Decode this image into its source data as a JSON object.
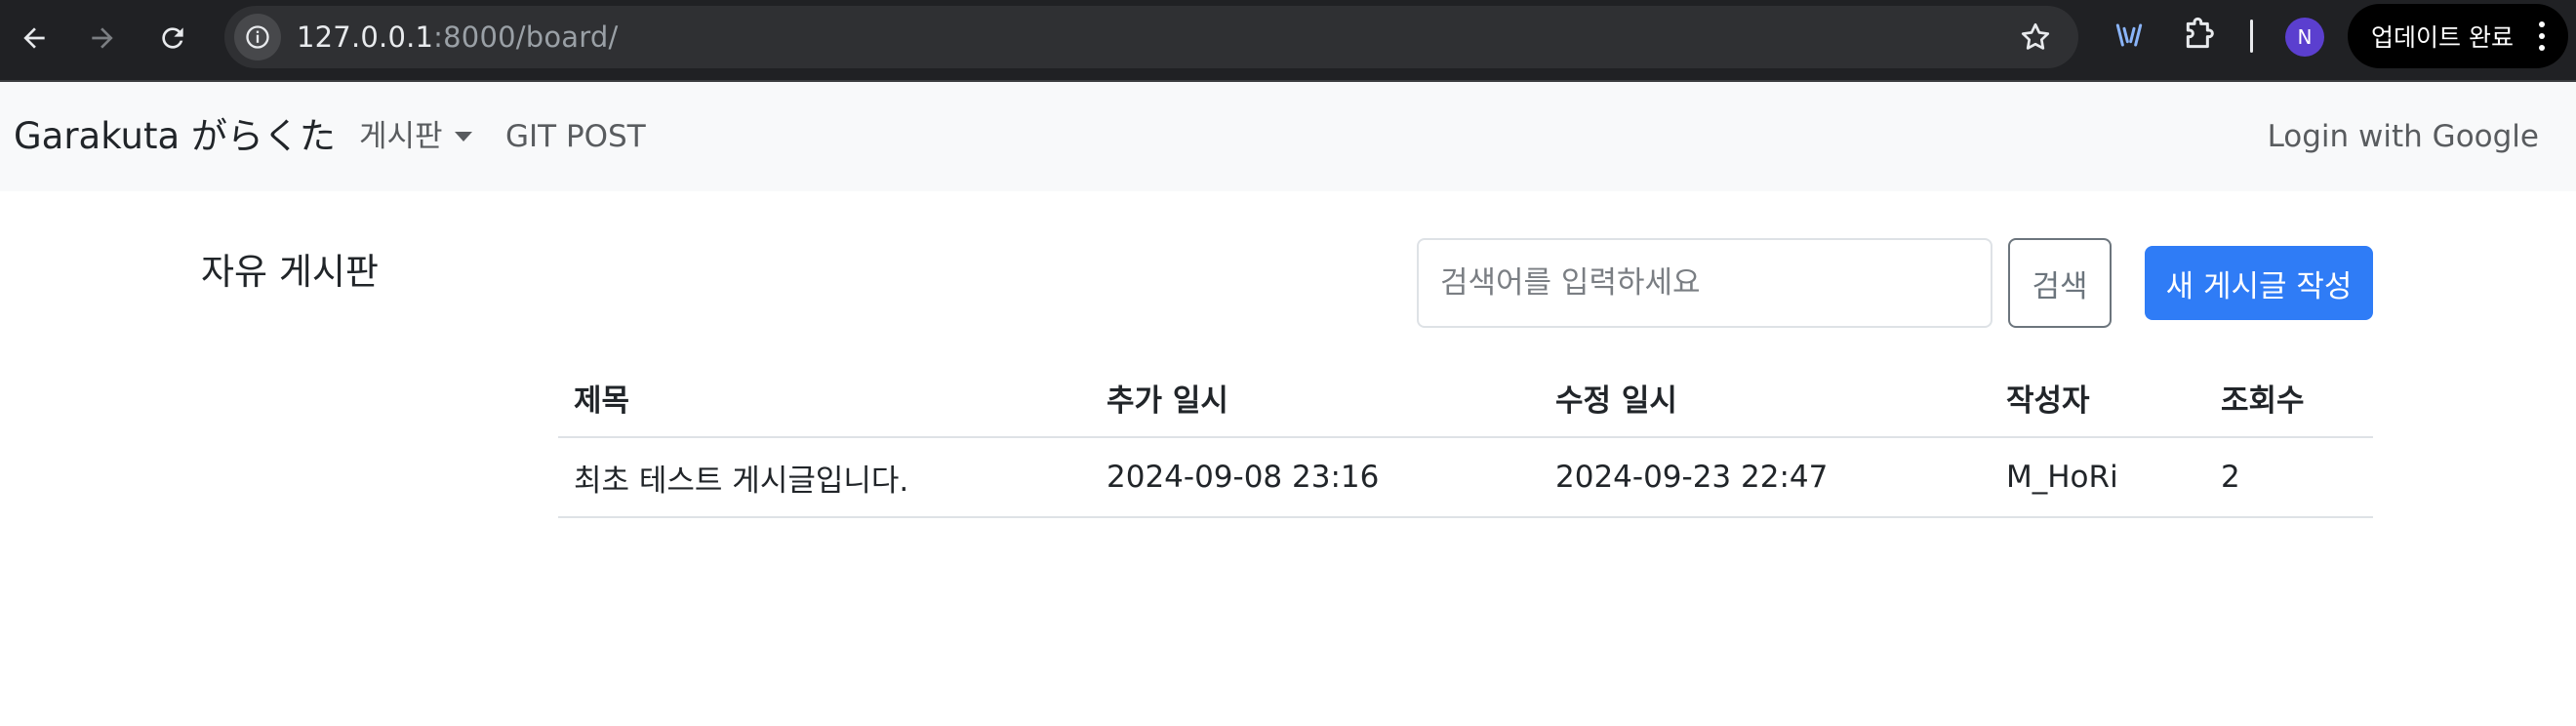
{
  "browser": {
    "url_host": "127.0.0.1",
    "url_path": ":8000/board/",
    "profile_initial": "N",
    "update_label": "업데이트 완료"
  },
  "navbar": {
    "brand": "Garakuta がらくた",
    "board_menu": "게시판",
    "git_post": "GIT POST",
    "login": "Login with Google"
  },
  "board": {
    "title": "자유 게시판",
    "search_placeholder": "검색어를 입력하세요",
    "search_button": "검색",
    "new_post_button": "새 게시글 작성",
    "columns": {
      "title": "제목",
      "created": "추가 일시",
      "modified": "수정 일시",
      "author": "작성자",
      "views": "조회수"
    },
    "rows": [
      {
        "title": "최초 테스트 게시글입니다.",
        "created": "2024-09-08 23:16",
        "modified": "2024-09-23 22:47",
        "author": "M_HoRi",
        "views": "2"
      }
    ]
  },
  "colors": {
    "chrome_bg": "#202124",
    "navbar_bg": "#f8f9fa",
    "primary": "#2f7cf6",
    "secondary": "#6c757d"
  },
  "icons": [
    "back-icon",
    "forward-icon",
    "reload-icon",
    "site-info-icon",
    "bookmark-star-icon",
    "cast-icon",
    "extensions-icon",
    "menu-kebab-icon"
  ]
}
